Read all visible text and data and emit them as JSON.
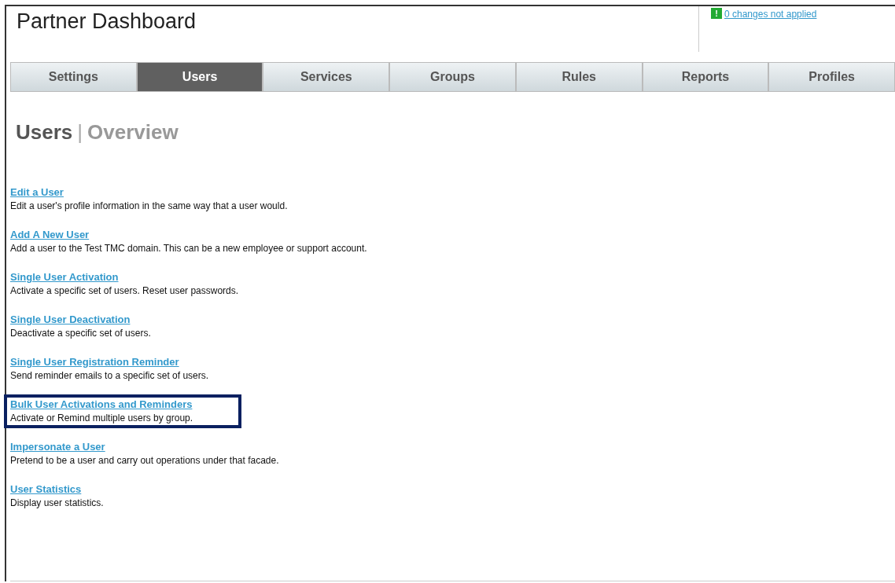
{
  "header": {
    "title": "Partner Dashboard",
    "changes_link": "0 changes not applied",
    "alert_icon_text": "!"
  },
  "tabs": [
    {
      "label": "Settings",
      "selected": false
    },
    {
      "label": "Users",
      "selected": true
    },
    {
      "label": "Services",
      "selected": false
    },
    {
      "label": "Groups",
      "selected": false
    },
    {
      "label": "Rules",
      "selected": false
    },
    {
      "label": "Reports",
      "selected": false
    },
    {
      "label": "Profiles",
      "selected": false
    }
  ],
  "heading": {
    "section": "Users",
    "separator": "|",
    "page": "Overview"
  },
  "items": [
    {
      "link": "Edit a User",
      "description": "Edit a user's profile information in the same way that a user would.",
      "highlighted": false
    },
    {
      "link": "Add A New User",
      "description": "Add a user to the Test TMC domain. This can be a new employee or support account.",
      "highlighted": false
    },
    {
      "link": "Single User Activation",
      "description": "Activate a specific set of users. Reset user passwords.",
      "highlighted": false
    },
    {
      "link": "Single User Deactivation",
      "description": "Deactivate a specific set of users.",
      "highlighted": false
    },
    {
      "link": "Single User Registration Reminder",
      "description": "Send reminder emails to a specific set of users.",
      "highlighted": false
    },
    {
      "link": "Bulk User Activations and Reminders",
      "description": "Activate or Remind multiple users by group.",
      "highlighted": true
    },
    {
      "link": "Impersonate a User",
      "description": "Pretend to be a user and carry out operations under that facade.",
      "highlighted": false
    },
    {
      "link": "User Statistics",
      "description": "Display user statistics.",
      "highlighted": false
    }
  ]
}
